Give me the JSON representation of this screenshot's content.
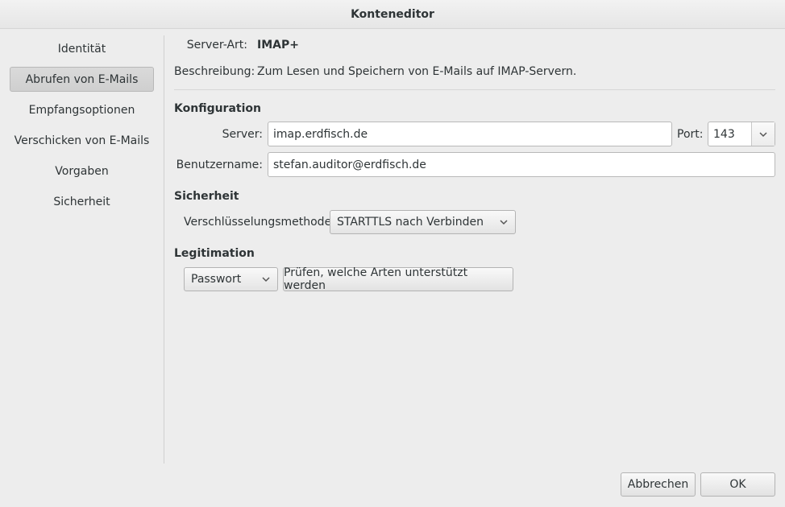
{
  "window": {
    "title": "Konteneditor"
  },
  "sidebar": {
    "items": [
      {
        "label": "Identität"
      },
      {
        "label": "Abrufen von E-Mails"
      },
      {
        "label": "Empfangsoptionen"
      },
      {
        "label": "Verschicken von E-Mails"
      },
      {
        "label": "Vorgaben"
      },
      {
        "label": "Sicherheit"
      }
    ],
    "selected": "Abrufen von E-Mails"
  },
  "info": {
    "server_type_label": "Server-Art:",
    "server_type_value": "IMAP+",
    "description_label": "Beschreibung:",
    "description_value": "Zum Lesen und Speichern von E-Mails auf IMAP-Servern."
  },
  "config": {
    "heading": "Konfiguration",
    "server_label": "Server:",
    "server_value": "imap.erdfisch.de",
    "port_label": "Port:",
    "port_value": "143",
    "username_label": "Benutzername:",
    "username_value": "stefan.auditor@erdfisch.de"
  },
  "security": {
    "heading": "Sicherheit",
    "encryption_label": "Verschlüsselungsmethode:",
    "encryption_value": "STARTTLS nach Verbinden"
  },
  "auth": {
    "heading": "Legitimation",
    "method_value": "Passwort",
    "check_button": "Prüfen, welche Arten unterstützt werden"
  },
  "footer": {
    "cancel_label": "Abbrechen",
    "ok_label": "OK"
  },
  "icons": {
    "combo_arrow": "chevron-down-icon",
    "spin_arrow": "chevron-down-icon"
  }
}
